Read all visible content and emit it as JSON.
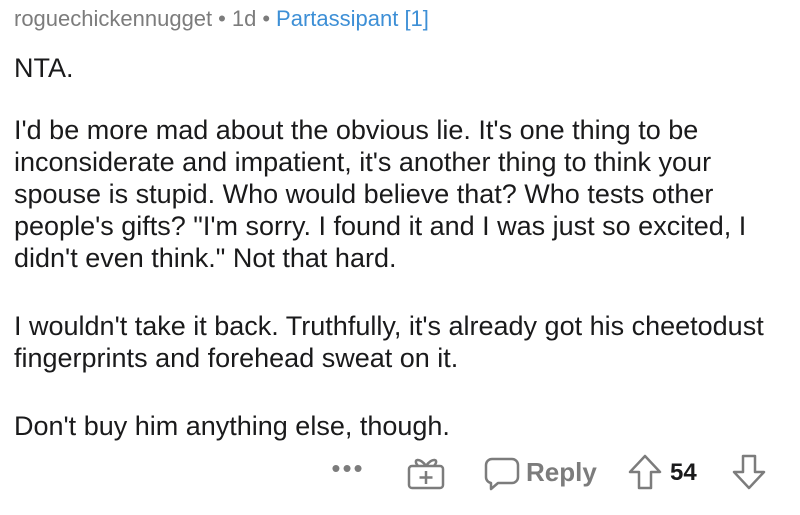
{
  "comment": {
    "author": "roguechickennugget",
    "age": "1d",
    "separator": "•",
    "flair": "Partassipant [1]",
    "paragraphs": [
      "NTA.",
      "I'd be more mad about the obvious lie. It's one thing to be inconsiderate and impatient, it's another thing to think your spouse is stupid. Who would believe that? Who tests other people's gifts? \"I'm sorry. I found it and I was just so excited, I didn't even think.\" Not that hard.",
      "I wouldn't take it back. Truthfully, it's already got his cheetodust fingerprints and forehead sweat on it.",
      "Don't buy him anything else, though."
    ]
  },
  "actions": {
    "more_label": "•••",
    "reply_label": "Reply",
    "score": "54",
    "icons": [
      "more-icon",
      "award-icon",
      "reply-icon",
      "upvote-icon",
      "downvote-icon"
    ]
  },
  "colors": {
    "meta_text": "#7c7c7c",
    "flair": "#3d8fd6",
    "body_text": "#1a1a1b",
    "icon": "#7c7c7c"
  }
}
